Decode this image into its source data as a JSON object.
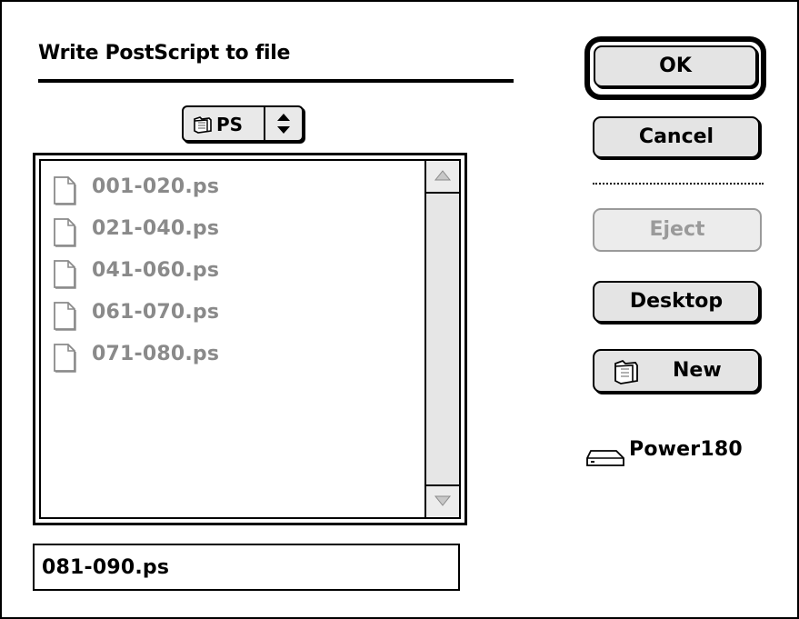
{
  "dialog": {
    "title": "Write PostScript to file"
  },
  "folder_popup": {
    "label": "PS",
    "icon": "folder-icon",
    "arrows_icon": "up-down-arrows-icon"
  },
  "file_list": {
    "items": [
      {
        "name": "001-020.ps",
        "icon": "document-icon"
      },
      {
        "name": "021-040.ps",
        "icon": "document-icon"
      },
      {
        "name": "041-060.ps",
        "icon": "document-icon"
      },
      {
        "name": "061-070.ps",
        "icon": "document-icon"
      },
      {
        "name": "071-080.ps",
        "icon": "document-icon"
      }
    ],
    "item_color": "#8a8a8a"
  },
  "filename_field": {
    "value": "081-090.ps"
  },
  "buttons": {
    "ok": "OK",
    "cancel": "Cancel",
    "eject": "Eject",
    "desktop": "Desktop",
    "new": "New"
  },
  "volume": {
    "name": "Power180",
    "icon": "hard-disk-icon"
  }
}
